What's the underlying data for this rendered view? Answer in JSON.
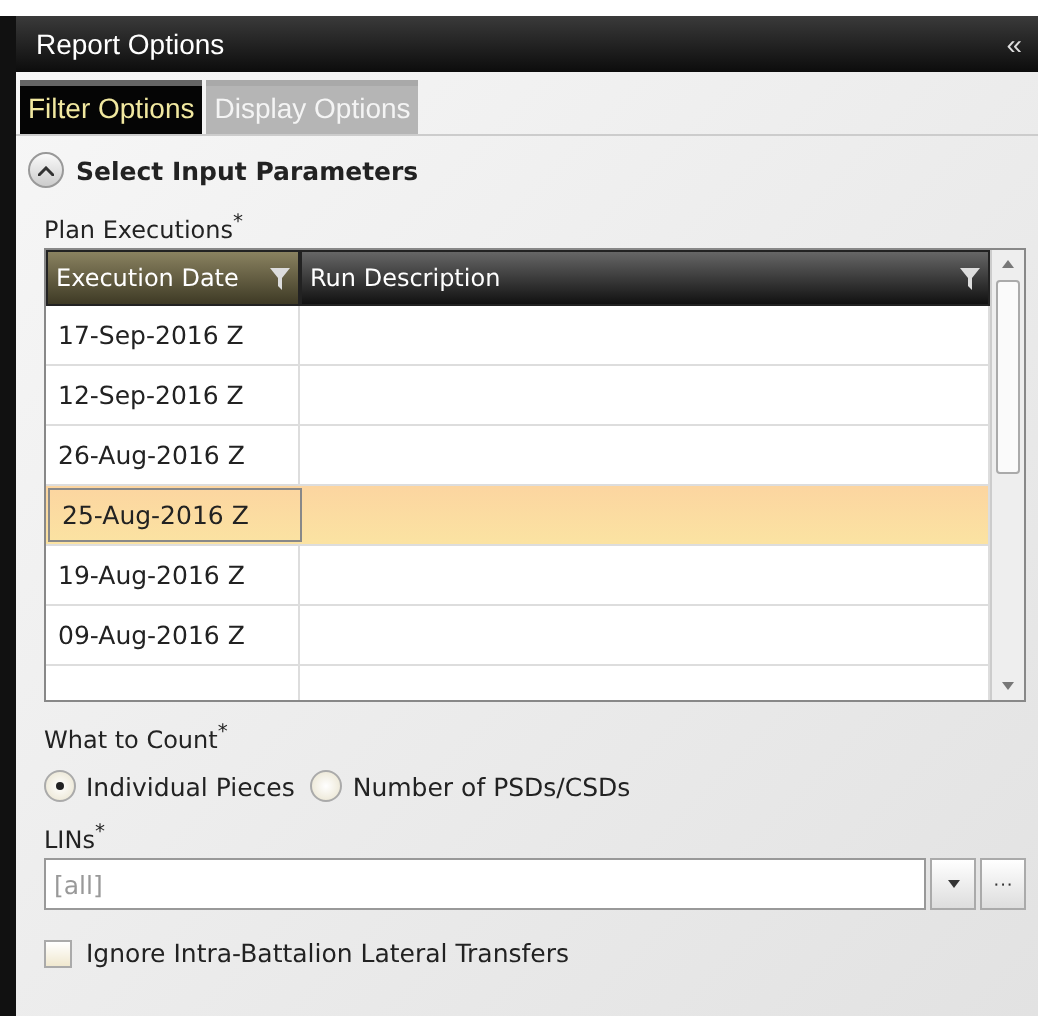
{
  "panel": {
    "title": "Report Options",
    "collapse_icon": "«"
  },
  "tabs": [
    {
      "label": "Filter Options",
      "selected": true
    },
    {
      "label": "Display Options",
      "selected": false
    }
  ],
  "section": {
    "title": "Select Input Parameters",
    "expanded": true
  },
  "plan_executions": {
    "label": "Plan Executions$^{*}$",
    "columns": [
      "Execution Date",
      "Run Description"
    ],
    "rows": [
      {
        "execution_date": "17-Sep-2016 Z",
        "run_description": "",
        "selected": false
      },
      {
        "execution_date": "12-Sep-2016 Z",
        "run_description": "",
        "selected": false
      },
      {
        "execution_date": "26-Aug-2016 Z",
        "run_description": "",
        "selected": false
      },
      {
        "execution_date": "25-Aug-2016 Z",
        "run_description": "",
        "selected": true
      },
      {
        "execution_date": "19-Aug-2016 Z",
        "run_description": "",
        "selected": false
      },
      {
        "execution_date": "09-Aug-2016 Z",
        "run_description": "",
        "selected": false
      }
    ]
  },
  "what_to_count": {
    "label": "What to Count$^{*}$",
    "options": [
      {
        "label": "Individual Pieces",
        "selected": true
      },
      {
        "label": "Number of PSDs/CSDs",
        "selected": false
      }
    ]
  },
  "lins": {
    "label": "LINs$^{*}$",
    "placeholder": "[all]",
    "more_button": "···"
  },
  "ignore_transfers": {
    "label": "Ignore Intra-Battalion Lateral Transfers",
    "checked": false
  }
}
